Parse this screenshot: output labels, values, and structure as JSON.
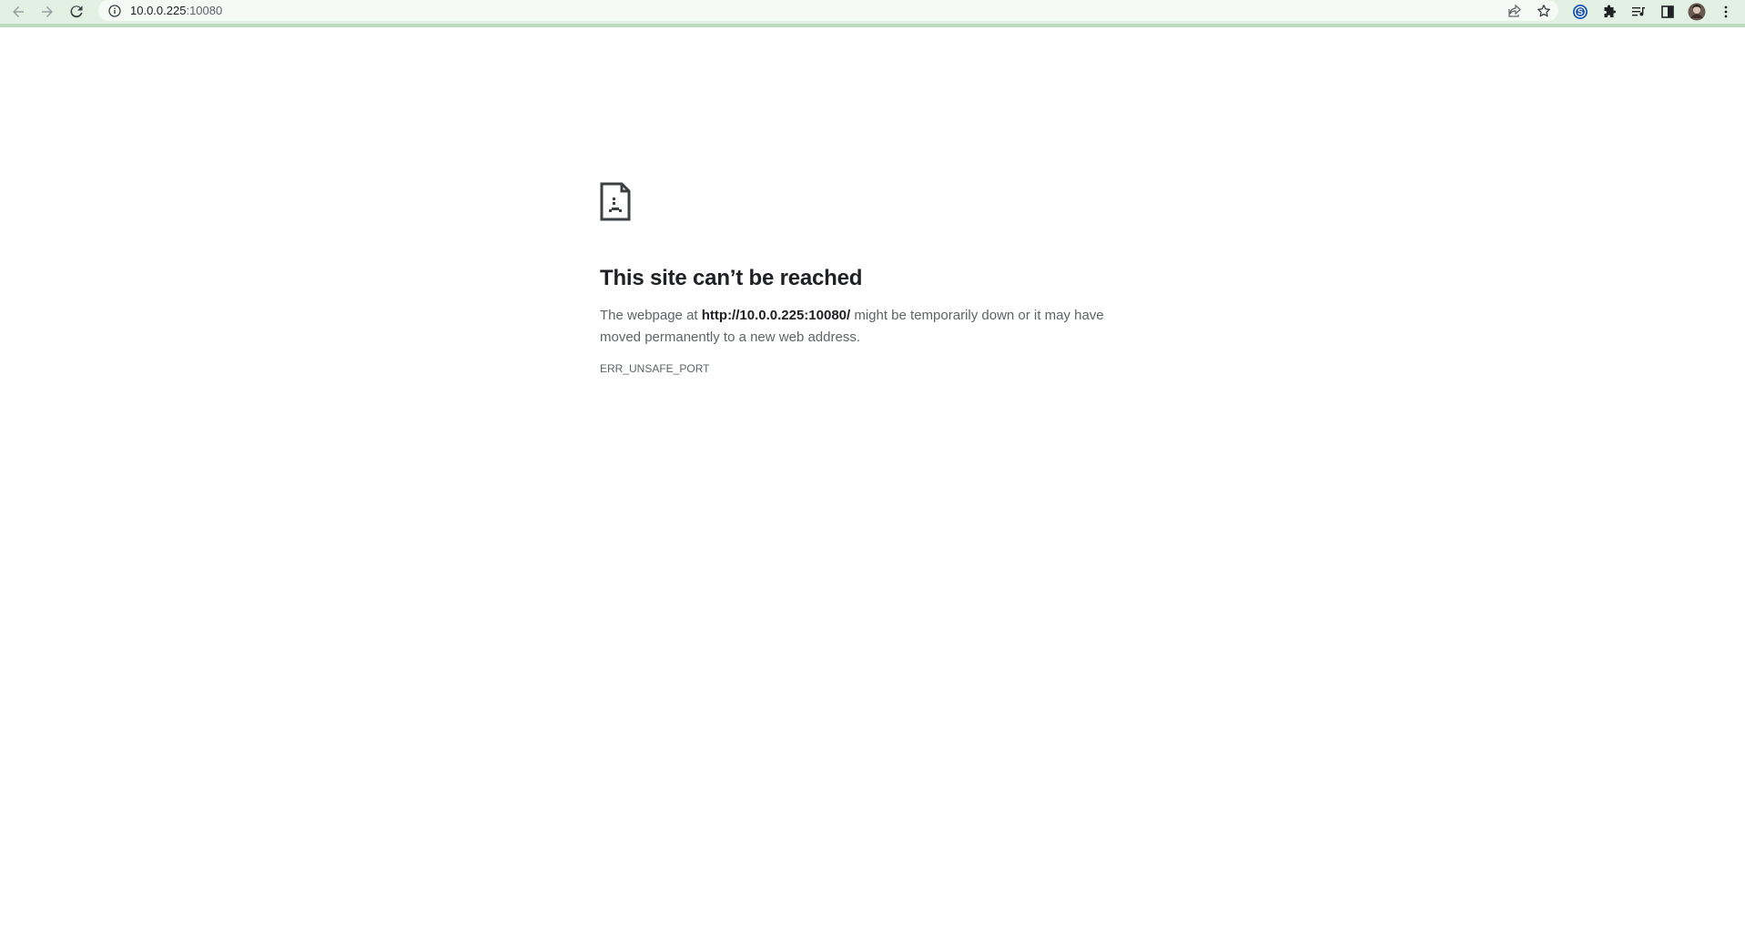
{
  "browser": {
    "url_host": "10.0.0.225",
    "url_port": ":10080"
  },
  "error_page": {
    "title": "This site can’t be reached",
    "desc_prefix": "The webpage at ",
    "desc_url": "http://10.0.0.225:10080/",
    "desc_suffix": " might be temporarily down or it may have moved permanently to a new web address.",
    "error_code": "ERR_UNSAFE_PORT"
  },
  "icons": [
    "back-icon",
    "forward-icon",
    "reload-icon",
    "info-icon",
    "share-icon",
    "star-icon",
    "extension-s-icon",
    "puzzle-icon",
    "reading-list-icon",
    "side-panel-icon",
    "profile-avatar",
    "menu-kebab-icon",
    "sad-page-icon"
  ],
  "colors": {
    "toolbar_bg": "#e3f1e5",
    "toolbar_border": "#b8dcbd",
    "text_primary": "#202124",
    "text_secondary": "#5f6368"
  }
}
